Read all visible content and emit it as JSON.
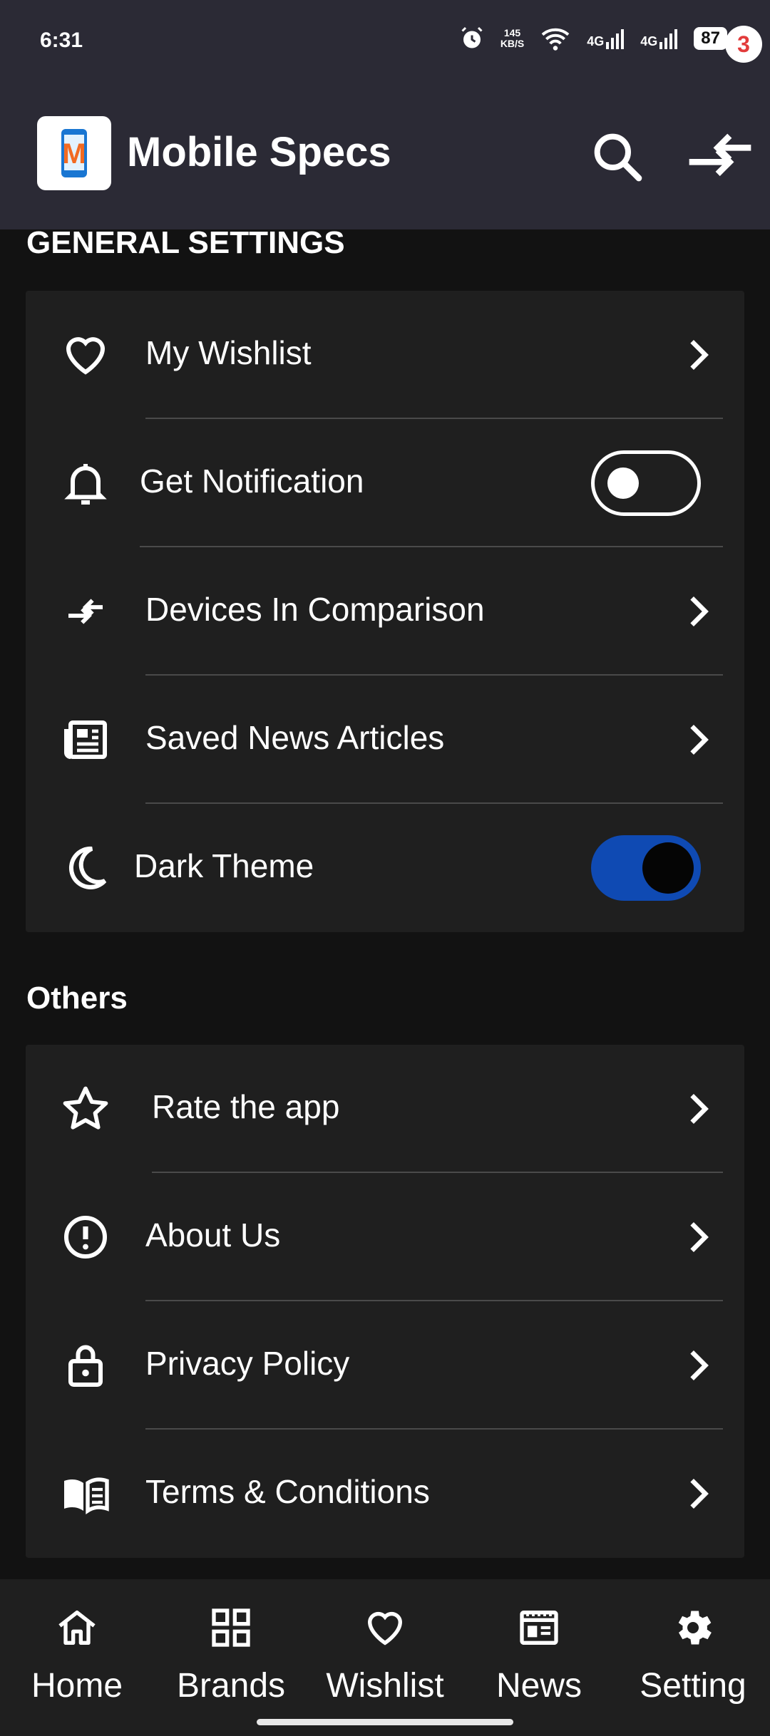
{
  "status_bar": {
    "time": "6:31",
    "net_speed_top": "145",
    "net_speed_unit": "KB/S",
    "net_type_1": "4G",
    "net_type_2": "4G",
    "battery": "87"
  },
  "app_bar": {
    "title": "Mobile Specs",
    "logo_letter": "M",
    "compare_count": "3"
  },
  "general": {
    "title": "GENERAL SETTINGS",
    "items": [
      {
        "label": "My Wishlist",
        "icon": "heart-icon"
      },
      {
        "label": "Get Notification",
        "icon": "bell-icon",
        "toggle": false
      },
      {
        "label": "Devices In Comparison",
        "icon": "compare-arrows-icon"
      },
      {
        "label": "Saved News Articles",
        "icon": "newspaper-icon"
      },
      {
        "label": "Dark Theme",
        "icon": "moon-icon",
        "toggle": true
      }
    ]
  },
  "others": {
    "title": "Others",
    "items": [
      {
        "label": "Rate the app",
        "icon": "star-icon"
      },
      {
        "label": "About Us",
        "icon": "info-icon"
      },
      {
        "label": "Privacy Policy",
        "icon": "lock-icon"
      },
      {
        "label": "Terms & Conditions",
        "icon": "book-icon"
      }
    ]
  },
  "bottom_nav": {
    "items": [
      {
        "label": "Home",
        "icon": "home-icon"
      },
      {
        "label": "Brands",
        "icon": "grid-icon"
      },
      {
        "label": "Wishlist",
        "icon": "heart-icon"
      },
      {
        "label": "News",
        "icon": "news-icon"
      },
      {
        "label": "Setting",
        "icon": "gear-icon"
      }
    ],
    "active": "Setting"
  },
  "colors": {
    "background": "#121212",
    "app_bar": "#2b2a35",
    "card": "#1f1f1f",
    "toggle_on": "#0f4ab3",
    "badge_text": "#e23b3b"
  }
}
